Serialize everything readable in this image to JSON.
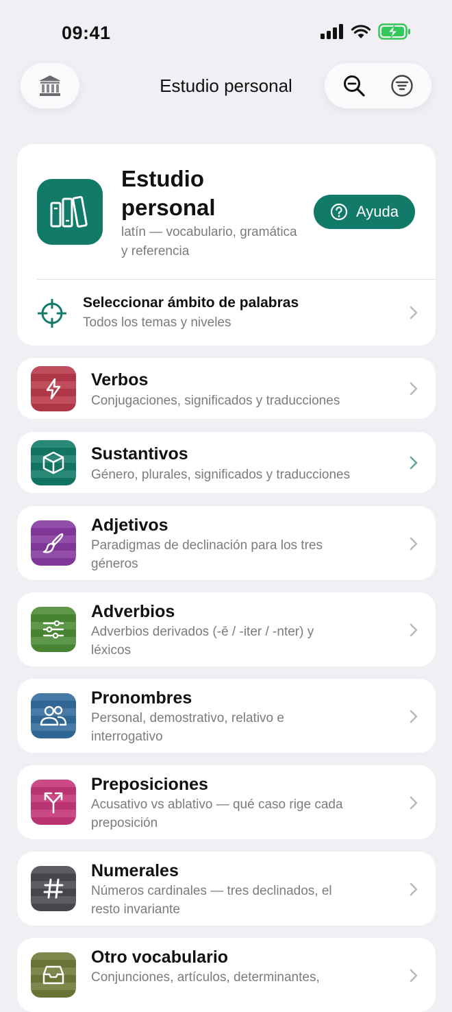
{
  "status": {
    "time": "09:41"
  },
  "nav": {
    "title": "Estudio personal"
  },
  "header": {
    "title": "Estudio personal",
    "subtitle": "latín — vocabulario, gramática y referencia",
    "help_label": "Ayuda"
  },
  "scope": {
    "title": "Seleccionar ámbito de palabras",
    "subtitle": "Todos los temas y niveles"
  },
  "categories": [
    {
      "title": "Verbos",
      "subtitle": "Conjugaciones, significados y traducciones",
      "color": "#b8394a",
      "icon": "bolt-icon"
    },
    {
      "title": "Sustantivos",
      "subtitle": "Género, plurales, significados y traducciones",
      "color": "#127a68",
      "icon": "cube-icon"
    },
    {
      "title": "Adjetivos",
      "subtitle": "Paradigmas de declinación para los tres géneros",
      "color": "#86399e",
      "icon": "brush-icon"
    },
    {
      "title": "Adverbios",
      "subtitle": "Adverbios derivados (-ē / -iter / -nter) y léxicos",
      "color": "#4c8a35",
      "icon": "sliders-icon"
    },
    {
      "title": "Pronombres",
      "subtitle": "Personal, demostrativo, relativo e interrogativo",
      "color": "#336b9c",
      "icon": "people-icon"
    },
    {
      "title": "Preposiciones",
      "subtitle": "Acusativo vs ablativo — qué caso rige cada preposición",
      "color": "#c43678",
      "icon": "fork-icon"
    },
    {
      "title": "Numerales",
      "subtitle": "Números cardinales — tres declinados, el resto invariante",
      "color": "#4a4a50",
      "icon": "hash-icon"
    },
    {
      "title": "Otro vocabulario",
      "subtitle": "Conjunciones, artículos, determinantes,",
      "color": "#6e7a38",
      "icon": "tray-icon"
    }
  ],
  "colors": {
    "accent": "#127a68",
    "background": "#f0eff4"
  }
}
